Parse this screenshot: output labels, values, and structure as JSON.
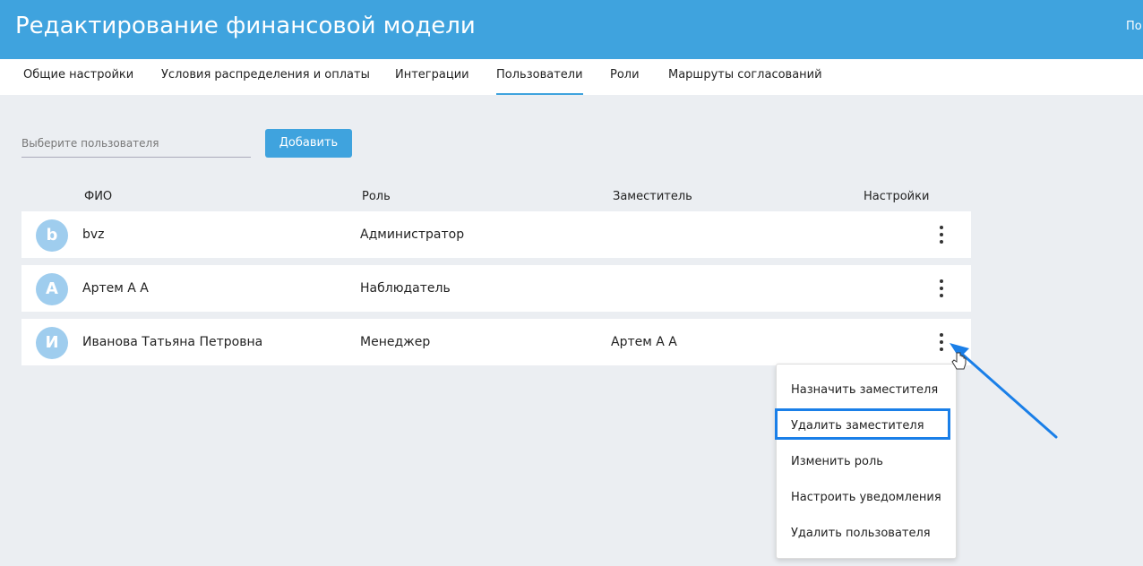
{
  "header": {
    "title": "Редактирование финансовой модели",
    "right_text": "По"
  },
  "tabs": [
    {
      "label": "Общие настройки"
    },
    {
      "label": "Условия распределения и оплаты"
    },
    {
      "label": "Интеграции"
    },
    {
      "label": "Пользователи",
      "active": true
    },
    {
      "label": "Роли"
    },
    {
      "label": "Маршруты согласований"
    }
  ],
  "toolbar": {
    "user_placeholder": "Выберите пользователя",
    "add_label": "Добавить"
  },
  "table": {
    "headers": [
      "ФИО",
      "Роль",
      "Заместитель",
      "Настройки"
    ],
    "rows": [
      {
        "initial": "b",
        "name": "bvz",
        "role": "Администратор",
        "deputy": ""
      },
      {
        "initial": "А",
        "name": "Артем А А",
        "role": "Наблюдатель",
        "deputy": ""
      },
      {
        "initial": "И",
        "name": "Иванова Татьяна Петровна",
        "role": "Менеджер",
        "deputy": "Артем А А"
      }
    ]
  },
  "menu": {
    "items": [
      "Назначить заместителя",
      "Удалить заместителя",
      "Изменить роль",
      "Настроить уведомления",
      "Удалить пользователя"
    ],
    "highlighted": "Удалить заместителя"
  },
  "colors": {
    "accent": "#3fa3de",
    "highlight": "#1a7fe8",
    "avatar": "#9fcdee"
  }
}
